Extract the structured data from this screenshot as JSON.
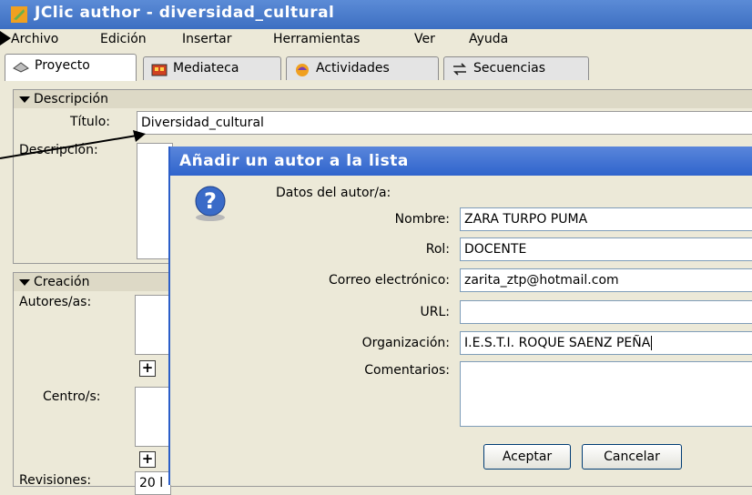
{
  "window": {
    "title": "JClic author - diversidad_cultural"
  },
  "menu": [
    "Archivo",
    "Edición",
    "Insertar",
    "Herramientas",
    "Ver",
    "Ayuda"
  ],
  "tabs": [
    {
      "label": "Proyecto",
      "icon": "project-icon",
      "active": true
    },
    {
      "label": "Mediateca",
      "icon": "media-library-icon",
      "active": false
    },
    {
      "label": "Actividades",
      "icon": "activities-icon",
      "active": false
    },
    {
      "label": "Secuencias",
      "icon": "sequences-icon",
      "active": false
    }
  ],
  "descripcion": {
    "header": "Descripción",
    "title_label": "Título:",
    "title_value": "Diversidad_cultural",
    "desc_label": "Descripción:"
  },
  "creacion": {
    "header": "Creación",
    "authors_label": "Autores/as:",
    "centers_label": "Centro/s:",
    "revisions_label": "Revisiones:",
    "revisions_value": "20 l"
  },
  "dialog": {
    "title": "Añadir un autor a la lista",
    "heading": "Datos del autor/a:",
    "fields": {
      "nombre_label": "Nombre:",
      "nombre_value": "ZARA TURPO PUMA",
      "rol_label": "Rol:",
      "rol_value": "DOCENTE",
      "correo_label": "Correo electrónico:",
      "correo_value": "zarita_ztp@hotmail.com",
      "url_label": "URL:",
      "url_value": "",
      "org_label": "Organización:",
      "org_value": "I.E.S.T.I. ROQUE SAENZ PEÑA",
      "comentarios_label": "Comentarios:",
      "comentarios_value": ""
    },
    "accept_label": "Aceptar",
    "cancel_label": "Cancelar"
  },
  "colors": {
    "titlebar": "#3d6fc2",
    "dialog_titlebar": "#2f64cc",
    "window_bg": "#ece9d8"
  }
}
